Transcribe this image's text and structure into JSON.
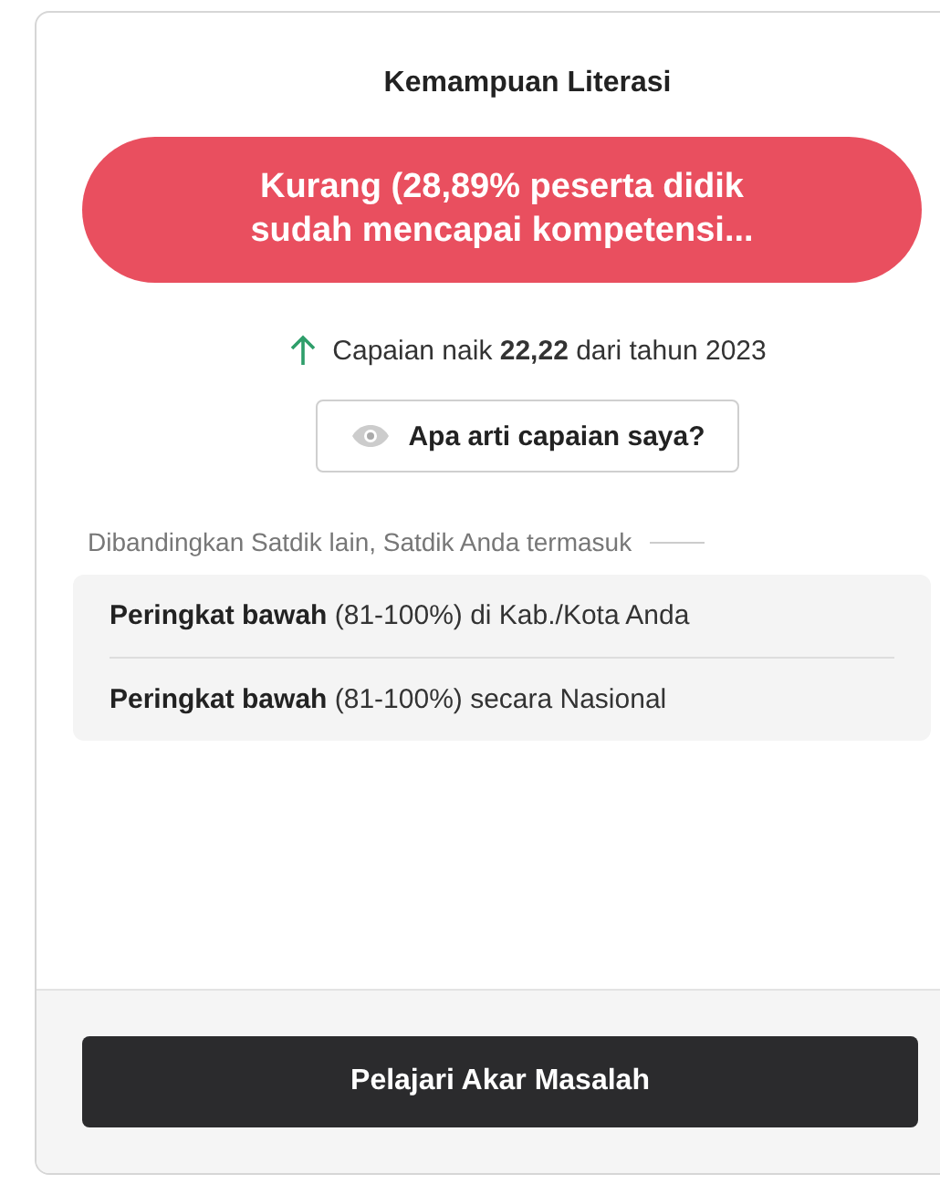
{
  "card": {
    "title": "Kemampuan Literasi",
    "status": {
      "label": "Kurang (28,89% peserta didik sudah mencapai kompetensi..."
    },
    "trend": {
      "increased": true,
      "text": "Capaian naik **22,22** dari tahun 2023"
    },
    "help_button": {
      "label": "Apa arti capaian saya?"
    },
    "comparison": {
      "caption": "Dibandingkan Satdik lain, Satdik Anda termasuk",
      "items": [
        {
          "text": "**Peringkat bawah** (81-100%) di Kab./Kota Anda"
        },
        {
          "text": "**Peringkat bawah** (81-100%) secara Nasional"
        }
      ]
    },
    "action_button": {
      "label": "Pelajari Akar Masalah"
    }
  }
}
